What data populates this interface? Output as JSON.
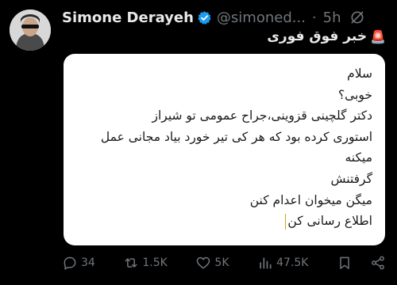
{
  "author": {
    "display_name": "Simone Derayeh",
    "handle": "@simoned...",
    "separator": "·",
    "time": "5h",
    "verified_icon": "verified-badge-icon",
    "accent_color": "#1d9bf0"
  },
  "tweet": {
    "headline": "خبر فوق فوری",
    "headline_icon": "siren-icon",
    "note_lines": [
      "سلام",
      "خوبی؟",
      "دکتر گلچینی قزوینی،جراح عمومی تو شیراز",
      "استوری کرده بود که هر کی تیر خورد بیاد مجانی عمل",
      "میکنه",
      "گرفتنش",
      "میگن میخوان اعدام کنن",
      "اطلاع رسانی کن"
    ]
  },
  "actions": {
    "replies": "34",
    "reposts": "1.5K",
    "likes": "5K",
    "views": "47.5K"
  }
}
